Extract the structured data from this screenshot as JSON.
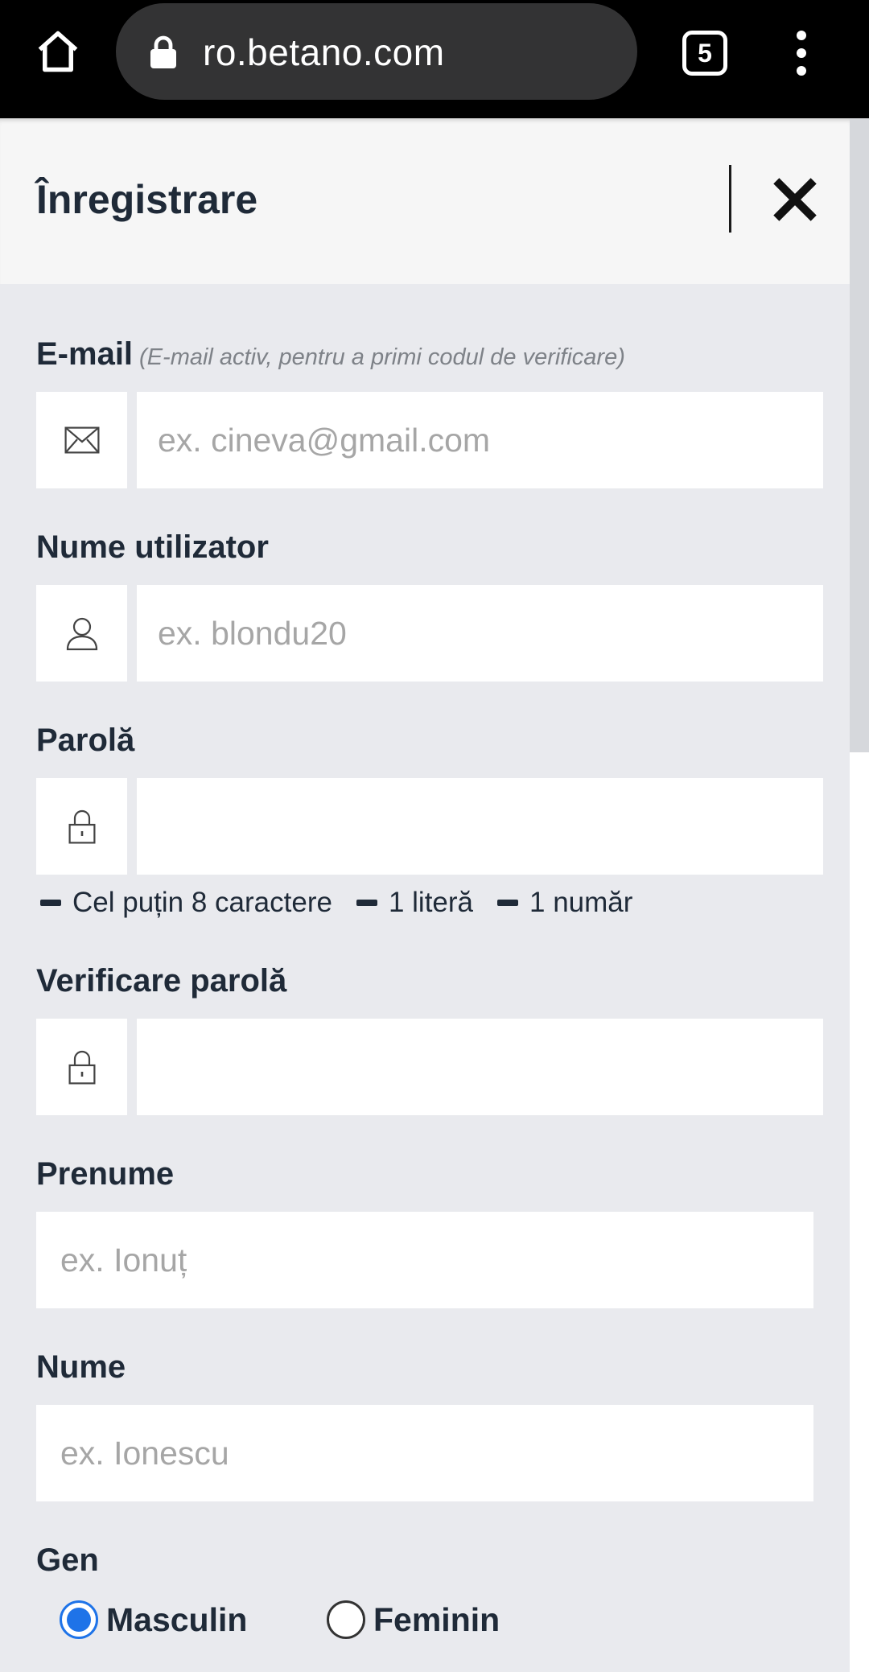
{
  "browser": {
    "url": "ro.betano.com",
    "tab_count": "5"
  },
  "modal": {
    "title": "Înregistrare"
  },
  "form": {
    "email": {
      "label": "E-mail",
      "hint": "(E-mail activ, pentru a primi codul de verificare)",
      "placeholder": "ex. cineva@gmail.com",
      "icon": "envelope-icon"
    },
    "username": {
      "label": "Nume utilizator",
      "placeholder": "ex. blondu20",
      "icon": "user-icon"
    },
    "password": {
      "label": "Parolă",
      "placeholder": "",
      "icon": "padlock-icon",
      "requirements": [
        "Cel puțin 8 caractere",
        "1 literă",
        "1 număr"
      ]
    },
    "password_confirm": {
      "label": "Verificare parolă",
      "placeholder": "",
      "icon": "padlock-icon"
    },
    "first_name": {
      "label": "Prenume",
      "placeholder": "ex. Ionuț"
    },
    "last_name": {
      "label": "Nume",
      "placeholder": "ex. Ionescu"
    },
    "gender": {
      "label": "Gen",
      "options": [
        {
          "label": "Masculin",
          "selected": true
        },
        {
          "label": "Feminin",
          "selected": false
        }
      ]
    }
  },
  "colors": {
    "accent": "#1e73e8",
    "text": "#1f2a38",
    "page_bg": "#e9eaee",
    "header_bg": "#f6f6f6"
  }
}
